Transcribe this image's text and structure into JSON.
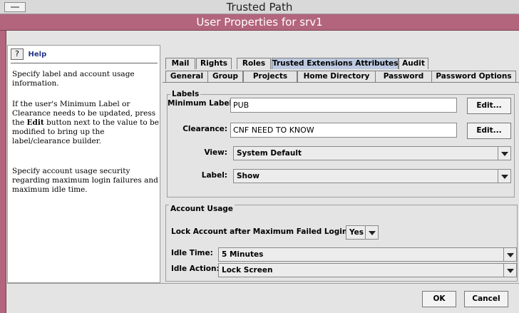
{
  "trusted_path": {
    "title": "Trusted Path"
  },
  "window": {
    "title": "User Properties for srv1"
  },
  "help": {
    "title": "Help",
    "paragraphs": [
      "Specify label and account usage information.",
      "If the user's Minimum Label or Clearance needs to be updated, press the",
      "Edit",
      "button next to the value to be modified to bring up the label/clearance builder.",
      "Specify account usage security regarding maximum login failures and maximum idle time."
    ]
  },
  "tabs": {
    "row1": [
      "Mail",
      "Rights",
      "Roles",
      "Trusted Extensions Attributes",
      "Audit"
    ],
    "row2": [
      "General",
      "Group",
      "Projects",
      "Home Directory",
      "Password",
      "Password Options"
    ],
    "active": "Trusted Extensions Attributes"
  },
  "labels_group": {
    "legend": "Labels",
    "minimum_label": {
      "label": "Minimum Label:",
      "value": "PUB",
      "edit": "Edit..."
    },
    "clearance": {
      "label": "Clearance:",
      "value": "CNF NEED TO KNOW",
      "edit": "Edit..."
    },
    "view": {
      "label": "View:",
      "value": "System Default"
    },
    "label": {
      "label": "Label:",
      "value": "Show"
    }
  },
  "account_usage": {
    "legend": "Account Usage",
    "lock": {
      "label": "Lock Account after Maximum Failed Logins:",
      "value": "Yes"
    },
    "idle_time": {
      "label": "Idle Time:",
      "value": "5 Minutes"
    },
    "idle_action": {
      "label": "Idle Action:",
      "value": "Lock Screen"
    }
  },
  "buttons": {
    "ok": "OK",
    "cancel": "Cancel"
  },
  "colors": {
    "title_bar": "#b3657e",
    "active_tab": "#bcc9e0",
    "help_title": "#26368a"
  },
  "icons": {
    "help": "help-question-icon",
    "dropdown": "chevron-down-icon",
    "trusted_menu": "menu-icon"
  }
}
